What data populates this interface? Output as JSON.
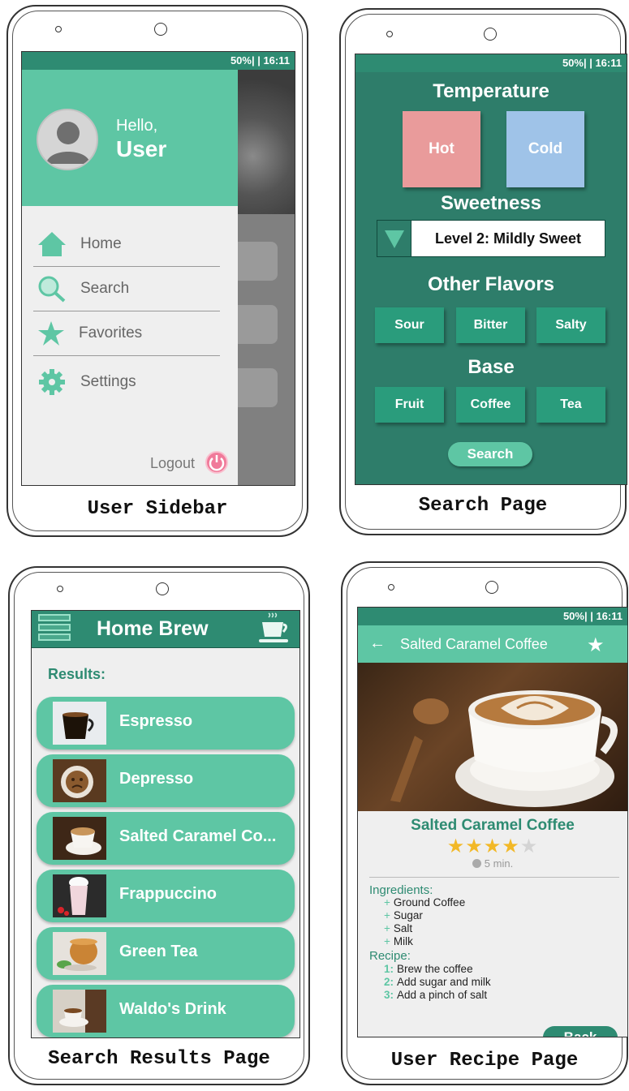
{
  "captions": {
    "sidebar": "User Sidebar",
    "search": "Search Page",
    "results": "Search Results Page",
    "recipe": "User Recipe Page"
  },
  "status": {
    "text": "50%| | 16:11"
  },
  "sidebar": {
    "greeting": "Hello,",
    "username": "User",
    "items": [
      {
        "label": "Home",
        "icon": "home-icon"
      },
      {
        "label": "Search",
        "icon": "search-icon"
      },
      {
        "label": "Favorites",
        "icon": "star-icon"
      },
      {
        "label": "Settings",
        "icon": "gear-icon"
      }
    ],
    "logout": "Logout"
  },
  "search_page": {
    "temperature_title": "Temperature",
    "temperature_options": [
      "Hot",
      "Cold"
    ],
    "sweetness_title": "Sweetness",
    "sweetness_value": "Level 2: Mildly Sweet",
    "flavors_title": "Other Flavors",
    "flavors": [
      "Sour",
      "Bitter",
      "Salty"
    ],
    "base_title": "Base",
    "bases": [
      "Fruit",
      "Coffee",
      "Tea"
    ],
    "search_button": "Search"
  },
  "results_page": {
    "app_title": "Home Brew",
    "results_label": "Results:",
    "items": [
      "Espresso",
      "Depresso",
      "Salted Caramel Co...",
      "Frappuccino",
      "Green Tea",
      "Waldo's Drink"
    ]
  },
  "recipe_page": {
    "header_title": "Salted Caramel Coffee",
    "name": "Salted Caramel Coffee",
    "rating": 4,
    "rating_max": 5,
    "time": "5 min.",
    "ingredients_label": "Ingredients:",
    "ingredients": [
      "Ground Coffee",
      "Sugar",
      "Salt",
      "Milk"
    ],
    "recipe_label": "Recipe:",
    "steps": [
      {
        "num": "1:",
        "text": "Brew the coffee"
      },
      {
        "num": "2:",
        "text": "Add sugar and milk"
      },
      {
        "num": "3:",
        "text": "Add a pinch of salt"
      }
    ],
    "back_button": "Back"
  },
  "colors": {
    "mint": "#5ec6a4",
    "teal_dark": "#2e8b72",
    "search_bg": "#2e7d6a",
    "hot": "#e99b9b",
    "cold": "#9fc3e8",
    "star": "#f2b827"
  }
}
